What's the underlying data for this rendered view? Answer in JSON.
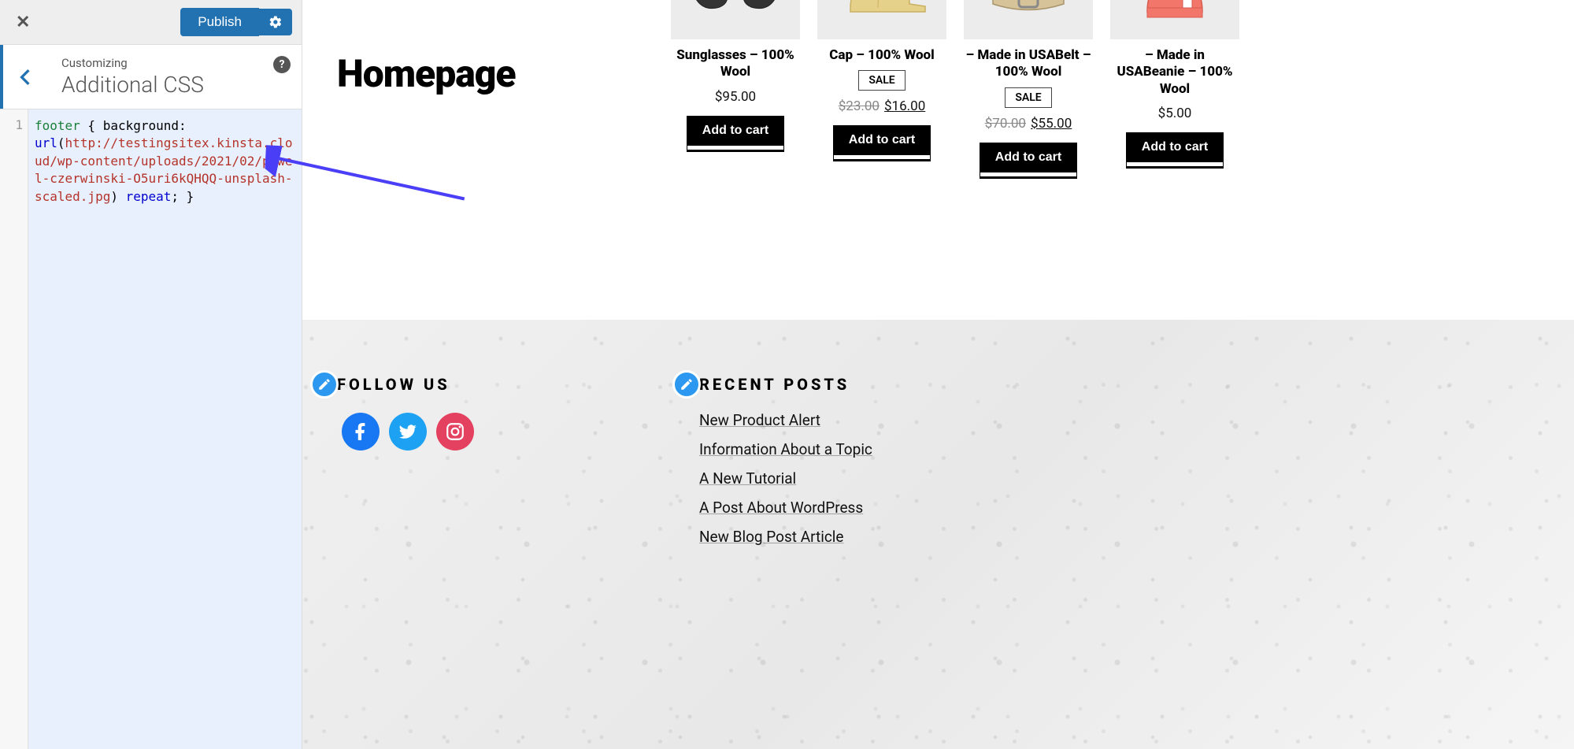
{
  "sidebar": {
    "publish_label": "Publish",
    "breadcrumb_small": "Customizing",
    "breadcrumb_large": "Additional CSS",
    "help_tip": "?",
    "line_number": "1",
    "code": {
      "selector": "footer",
      "open": " { ",
      "prop": "background:",
      "nl1": "\n",
      "url_kw": "url",
      "paren_open": "(",
      "url_val": "http://testingsitex.kinsta.cloud/wp-content/uploads/2021/02/pawel-czerwinski-O5uri6kQHQQ-unsplash-scaled.jpg",
      "paren_close": ")",
      "repeat": " repeat",
      "close": "; }"
    }
  },
  "preview": {
    "page_title": "Homepage",
    "products": [
      {
        "title": "Sunglasses – 100% Wool",
        "sale": false,
        "old_price": "",
        "price": "$95.00",
        "button": "Add to cart"
      },
      {
        "title": "Cap – 100% Wool",
        "sale": true,
        "old_price": "$23.00",
        "price": "$16.00",
        "button": "Add to cart"
      },
      {
        "title": "– Made in USABelt – 100% Wool",
        "sale": true,
        "old_price": "$70.00",
        "price": "$55.00",
        "button": "Add to cart"
      },
      {
        "title": "– Made in USABeanie – 100% Wool",
        "sale": false,
        "old_price": "",
        "price": "$5.00",
        "button": "Add to cart"
      }
    ],
    "sale_label": "SALE",
    "footer": {
      "follow_heading": "FOLLOW US",
      "recent_heading": "RECENT POSTS",
      "recent_posts": [
        "New Product Alert",
        "Information About a Topic",
        "A New Tutorial",
        "A Post About WordPress",
        "New Blog Post Article"
      ]
    }
  }
}
